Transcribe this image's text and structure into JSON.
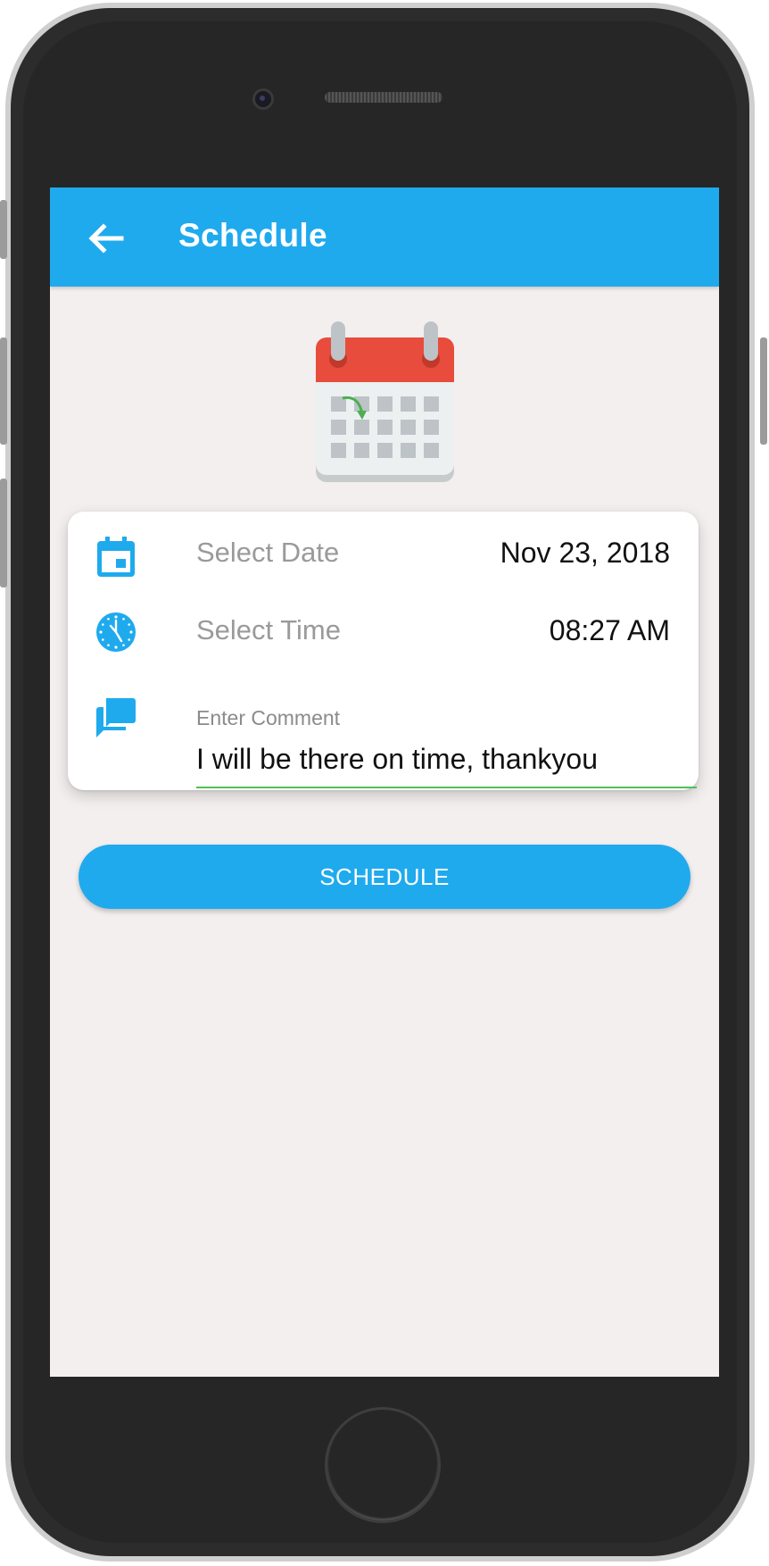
{
  "app_bar": {
    "title": "Schedule",
    "back_icon": "arrow-left-icon",
    "background_color": "#1faaee"
  },
  "illustration": {
    "icon": "calendar-icon",
    "colors": {
      "header": "#e74c3c",
      "body": "#ecf0f1",
      "arrow": "#4caf50"
    }
  },
  "form": {
    "date": {
      "icon": "event-calendar-icon",
      "label": "Select Date",
      "value": "Nov 23, 2018"
    },
    "time": {
      "icon": "clock-icon",
      "label": "Select Time",
      "value": "08:27 AM"
    },
    "comment": {
      "icon": "chat-bubbles-icon",
      "label": "Enter Comment",
      "value": "I will be there on time, thankyou",
      "underline_color": "#4cc25a"
    }
  },
  "actions": {
    "schedule_label": "SCHEDULE",
    "button_color": "#1faaee"
  }
}
